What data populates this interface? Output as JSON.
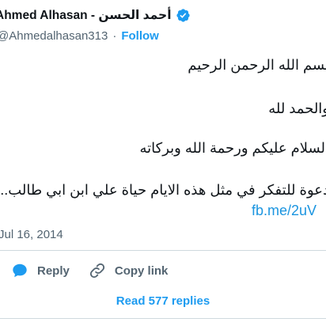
{
  "author": {
    "display_name": "Ahmed Alhasan - أحمد الحسن",
    "handle": "@Ahmedalhasan313",
    "separator": "·",
    "follow_label": "Follow",
    "verified_icon": "verified-badge-icon",
    "verified_color": "#1d9bf0"
  },
  "tweet": {
    "lines": [
      "بسم الله الرحمن الرحيم",
      "والحمد لله",
      "السلام عليكم ورحمة الله وبركاته",
      "دعوة للتفكر في مثل هذه الايام حياة علي ابن ابي طالب..."
    ],
    "link": "fb.me/2uV",
    "timestamp": "Jul 16, 2014"
  },
  "actions": {
    "reply_label": "Reply",
    "reply_icon": "speech-bubble-icon",
    "copy_label": "Copy link",
    "copy_icon": "link-icon"
  },
  "replies": {
    "label": "Read 577 replies"
  },
  "colors": {
    "accent": "#1d9bf0",
    "text": "#0f1419",
    "secondary": "#536471",
    "divider": "#cfd9de"
  }
}
